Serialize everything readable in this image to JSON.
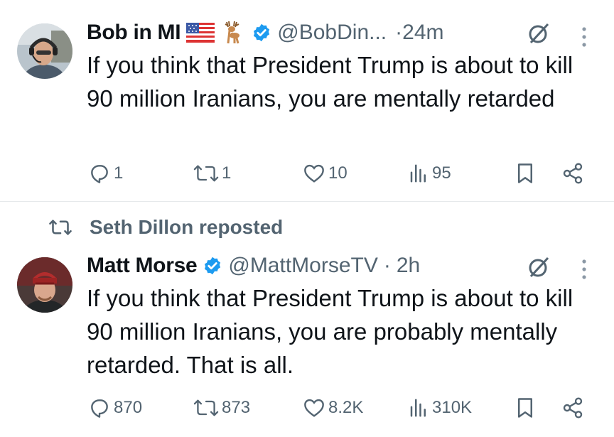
{
  "tweets": [
    {
      "name": "Bob in MI",
      "handle": "@BobDin...",
      "separator": "·",
      "time": "24m",
      "text": "If you think that President Trump is about to kill 90 million Iranians, you are mentally retarded",
      "stats": {
        "replies": "1",
        "reposts": "1",
        "likes": "10",
        "views": "95"
      }
    },
    {
      "repost_label": "Seth Dillon reposted",
      "name": "Matt Morse",
      "handle": "@MattMorseTV",
      "separator": "·",
      "time": "2h",
      "text": "If you think that President Trump is about to kill 90 million Iranians, you are probably mentally retarded. That is all.",
      "stats": {
        "replies": "870",
        "reposts": "873",
        "likes": "8.2K",
        "views": "310K"
      }
    }
  ],
  "colors": {
    "text": "#0f1419",
    "muted": "#536471",
    "verified": "#1d9bf0",
    "divider": "#e6e9eb"
  },
  "icons": [
    "reply-icon",
    "repost-icon",
    "like-icon",
    "views-icon",
    "bookmark-icon",
    "share-icon",
    "grok-icon",
    "more-icon",
    "verified-badge-icon",
    "us-flag-icon",
    "deer-icon"
  ]
}
